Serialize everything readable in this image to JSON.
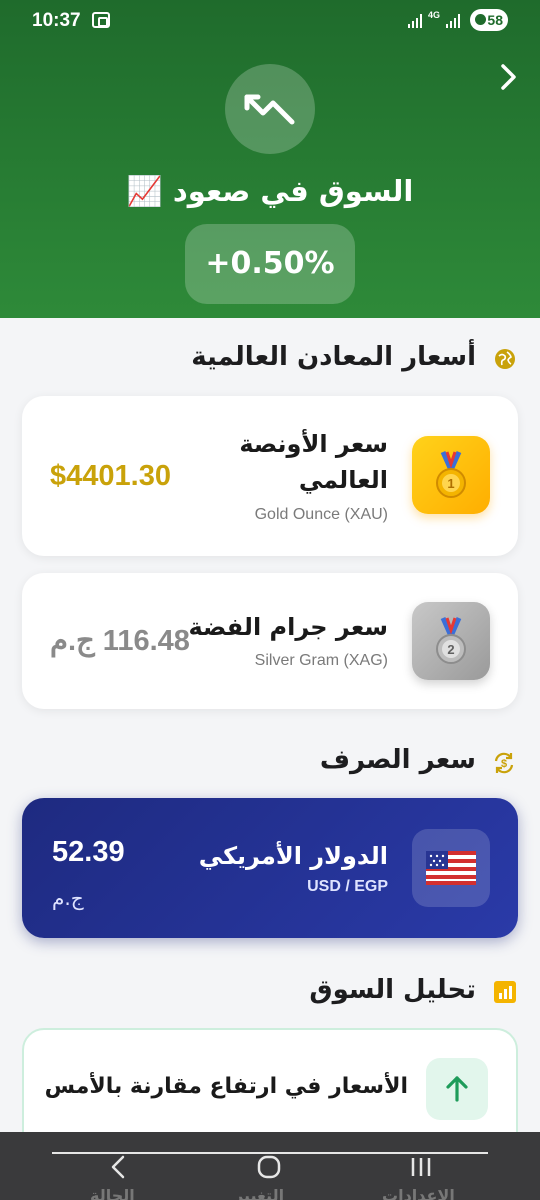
{
  "status_bar": {
    "time": "10:37",
    "network": "4G",
    "battery": "58"
  },
  "hero": {
    "title": "السوق في صعود 📈",
    "change": "+0.50%",
    "icon": "trending-down-icon",
    "nav_icon": "chevron-right-icon",
    "colors": {
      "top": "#1f6b2c",
      "bottom": "#2e8a39"
    }
  },
  "metals": {
    "section_title": "أسعار المعادن العالمية",
    "section_icon": "globe-icon",
    "items": [
      {
        "title": "سعر الأونصة العالمي",
        "subtitle": "Gold Ounce (XAU)",
        "price": "$4401.30",
        "icon": "gold-medal-icon",
        "price_color": "#c9a20a"
      },
      {
        "title": "سعر جرام الفضة",
        "subtitle": "Silver Gram (XAG)",
        "price": "116.48 ج.م",
        "icon": "silver-medal-icon",
        "price_color": "#8a8a8a"
      }
    ]
  },
  "exchange": {
    "section_title": "سعر الصرف",
    "section_icon": "currency-exchange-icon",
    "title": "الدولار الأمريكي",
    "pair": "USD / EGP",
    "value": "52.39",
    "unit": "ج.م",
    "icon": "us-flag-icon"
  },
  "analysis": {
    "section_title": "تحليل السوق",
    "section_icon": "bar-chart-icon",
    "text": "الأسعار في ارتفاع مقارنة بالأمس",
    "icon": "arrow-up-icon",
    "accent": "#1e9c5a"
  },
  "bottom_nav": {
    "items": [
      {
        "label": "الإعدادات",
        "icon": "menu-icon"
      },
      {
        "label": "التغيير",
        "icon": "home-circle-icon"
      },
      {
        "label": "الحالة",
        "icon": "back-chevron-icon"
      }
    ]
  }
}
